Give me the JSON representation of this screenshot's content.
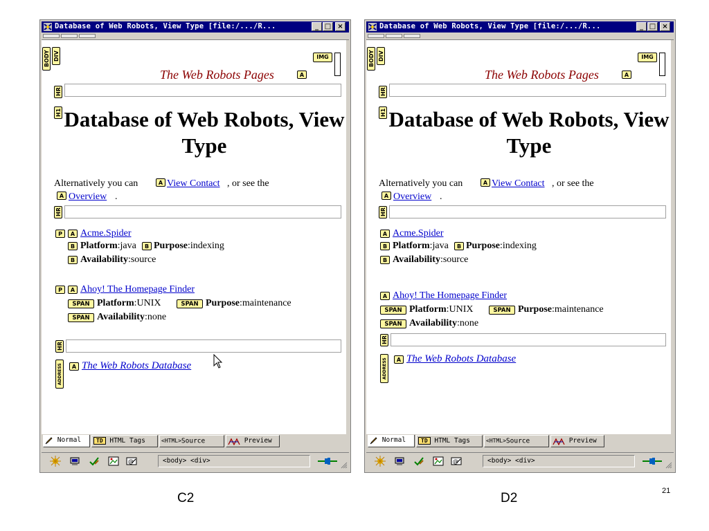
{
  "window_title": "Database of Web Robots, View Type [file:/.../R...",
  "window_buttons": {
    "minimize": "_",
    "maximize": "□",
    "close": "×"
  },
  "tags": {
    "body": "BODY",
    "div": "DIV",
    "img": "IMG",
    "a": "A",
    "hr": "HR",
    "h1": "H1",
    "p": "P",
    "b": "B",
    "span": "SPAN",
    "address": "ADDRESS"
  },
  "page": {
    "banner_link": "The Web Robots Pages",
    "heading": "Database of Web Robots, View Type",
    "intro_pre": "Alternatively you can",
    "intro_link1": "View Contact",
    "intro_mid": ", or see the",
    "intro_link2": "Overview",
    "intro_end": ".",
    "robot1": {
      "name": "Acme.Spider",
      "platform_label": "Platform",
      "platform_value": ":java",
      "purpose_label": "Purpose",
      "purpose_value": ":indexing",
      "availability_label": "Availability",
      "availability_value": ":source"
    },
    "robot2": {
      "name": "Ahoy! The Homepage Finder",
      "platform_label": "Platform",
      "platform_value": ":UNIX",
      "purpose_label": "Purpose",
      "purpose_value": ":maintenance",
      "availability_label": "Availability",
      "availability_value": ":none"
    },
    "address_link": "The Web Robots Database"
  },
  "tabs": {
    "normal": "Normal",
    "html_tags_icon": "TD",
    "html_tags": "HTML Tags",
    "source_icon": "<HTML>",
    "source": "Source",
    "preview": "Preview"
  },
  "status_tag_path": "<body> <div>",
  "captions": {
    "left": "C2",
    "right": "D2"
  },
  "page_number": "21",
  "colors": {
    "titlebar": "#000080",
    "tag_fill": "#fff7a0",
    "link": "#0000cc",
    "banner_text": "#8b0000",
    "chrome": "#d4d0c8"
  }
}
